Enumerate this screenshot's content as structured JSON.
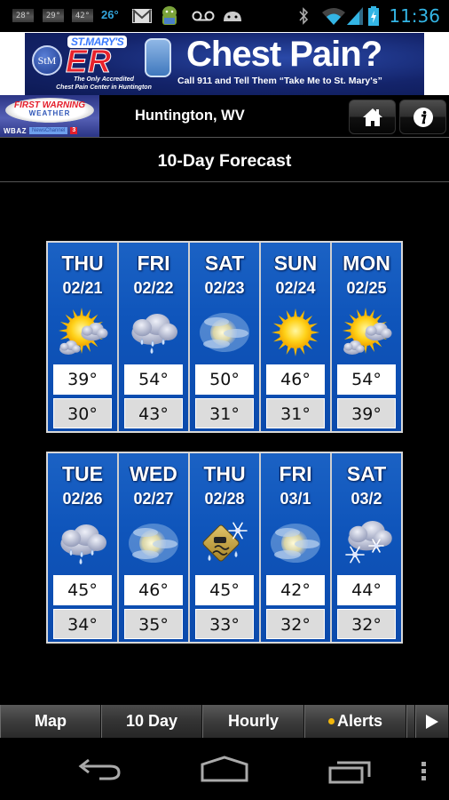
{
  "status_bar": {
    "notification_temps": [
      "28°",
      "29°",
      "42°"
    ],
    "current_temp": "26°",
    "icons": [
      "gmail-icon",
      "android-app-icon",
      "voicemail-icon",
      "android-icon",
      "bluetooth-icon",
      "wifi-icon",
      "signal-icon",
      "battery-charging-icon"
    ],
    "time": "11:36"
  },
  "ad": {
    "logo_initials": "StM",
    "brand": "ST.MARY'S",
    "brand_mark": "ER",
    "tagline_line1": "The Only Accredited",
    "tagline_line2": "Chest Pain Center in Huntington",
    "headline": "Chest Pain?",
    "subline": "Call 911 and Tell Them “Take Me to St. Mary's”"
  },
  "header": {
    "brand_line1": "FIRST WARNING",
    "brand_line2": "WEATHER",
    "brand_station": "WBAZ",
    "brand_channel": "NewsChannel",
    "brand_number": "3",
    "location": "Huntington, WV",
    "home_button": "home",
    "info_button": "info"
  },
  "page_title": "10-Day Forecast",
  "forecast": {
    "row1": [
      {
        "day": "THU",
        "date": "02/21",
        "icon": "partly-sunny",
        "high": "39°",
        "low": "30°"
      },
      {
        "day": "FRI",
        "date": "02/22",
        "icon": "rain",
        "high": "54°",
        "low": "43°"
      },
      {
        "day": "SAT",
        "date": "02/23",
        "icon": "hazy-cloudy",
        "high": "50°",
        "low": "31°"
      },
      {
        "day": "SUN",
        "date": "02/24",
        "icon": "sunny",
        "high": "46°",
        "low": "31°"
      },
      {
        "day": "MON",
        "date": "02/25",
        "icon": "partly-sunny",
        "high": "54°",
        "low": "39°"
      }
    ],
    "row2": [
      {
        "day": "TUE",
        "date": "02/26",
        "icon": "rain",
        "high": "45°",
        "low": "34°"
      },
      {
        "day": "WED",
        "date": "02/27",
        "icon": "hazy-cloudy",
        "high": "46°",
        "low": "35°"
      },
      {
        "day": "THU",
        "date": "02/28",
        "icon": "wintry-mix-slippery",
        "high": "45°",
        "low": "33°"
      },
      {
        "day": "FRI",
        "date": "03/1",
        "icon": "hazy-cloudy",
        "high": "42°",
        "low": "32°"
      },
      {
        "day": "SAT",
        "date": "03/2",
        "icon": "snow",
        "high": "44°",
        "low": "32°"
      }
    ]
  },
  "tabs": [
    {
      "label": "Map",
      "active": false
    },
    {
      "label": "10 Day",
      "active": true
    },
    {
      "label": "Hourly",
      "active": false
    },
    {
      "label": "Alerts",
      "active": false,
      "indicator_color": "#f2b70c"
    }
  ],
  "more_tabs_icon": "play-arrow-icon",
  "nav": [
    "back",
    "home",
    "recent-apps",
    "menu"
  ],
  "colors": {
    "card_blue": "#0f55bb",
    "clock_blue": "#33b5e5",
    "alert_dot": "#f2b70c"
  }
}
